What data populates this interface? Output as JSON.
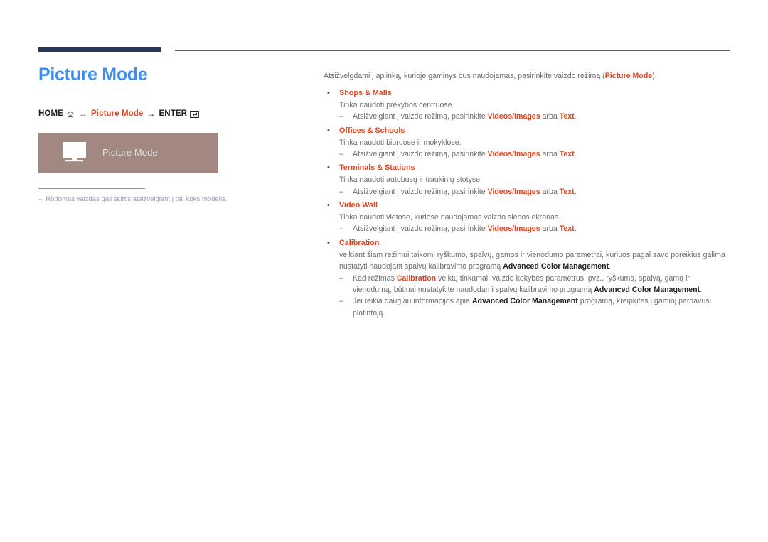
{
  "header": {
    "rule_dark_color": "#2b3654",
    "rule_thin_color": "#5b5b77"
  },
  "left": {
    "title": "Picture Mode",
    "title_color": "#3e8ef0",
    "breadcrumb": {
      "home_label": "HOME",
      "home_icon": "home-icon",
      "arrow1": "→",
      "middle_label": "Picture Mode",
      "arrow2": "→",
      "enter_label": "ENTER",
      "enter_icon": "enter-key-icon",
      "accent_color": "#e2431c"
    },
    "menu_box": {
      "icon": "monitor-icon",
      "label": "Picture Mode",
      "background_color": "#a18981"
    },
    "footnote": {
      "dash": "–",
      "text": "Rodomas vaizdas gali skirtis atsižvelgiant į tai, koks modelis."
    }
  },
  "right": {
    "intro_pre": "Atsižvelgdami į aplinką, kurioje gaminys bus naudojamas, pasirinkite vaizdo režimą (",
    "intro_accent": "Picture Mode",
    "intro_post": ").",
    "bullet_char": "•",
    "dash_char": "–",
    "sub_note_pre": "Atsižvelgiant į vaizdo režimą, pasirinkite ",
    "sub_note_opt1": "Videos/Images",
    "sub_note_mid": " arba ",
    "sub_note_opt2": "Text",
    "sub_note_post": ".",
    "items": [
      {
        "heading": "Shops & Malls",
        "description": "Tinka naudoti prekybos centruose."
      },
      {
        "heading": "Offices & Schools",
        "description": "Tinka naudoti biuruose ir mokyklose."
      },
      {
        "heading": "Terminals & Stations",
        "description": "Tinka naudoti autobusų ir traukinių stotyse."
      },
      {
        "heading": "Video Wall",
        "description": "Tinka naudoti vietose, kuriose naudojamas vaizdo sienos ekranas."
      }
    ],
    "calibration": {
      "heading": "Calibration",
      "description_pre": "veikiant šiam režimui taikomi ryškumo, spalvų, gamos ir vienodumo parametrai, kuriuos pagal savo poreikius galima nustatyti naudojant spalvų kalibravimo programą ",
      "description_bold": "Advanced Color Management",
      "description_post": ".",
      "notes": [
        {
          "pre": "Kad režimas ",
          "accent": "Calibration",
          "mid": " veiktų tinkamai, vaizdo kokybės parametrus, pvz., ryškumą, spalvą, gamą ir vienodumą, būtinai nustatykite naudodami spalvų kalibravimo programą ",
          "bold": "Advanced Color Management",
          "post": "."
        },
        {
          "pre": "Jei reikia daugiau informacijos apie ",
          "accent": "",
          "mid": "",
          "bold": "Advanced Color Management",
          "post": " programą, kreipkitės į gaminį pardavusi platintoją."
        }
      ]
    }
  }
}
